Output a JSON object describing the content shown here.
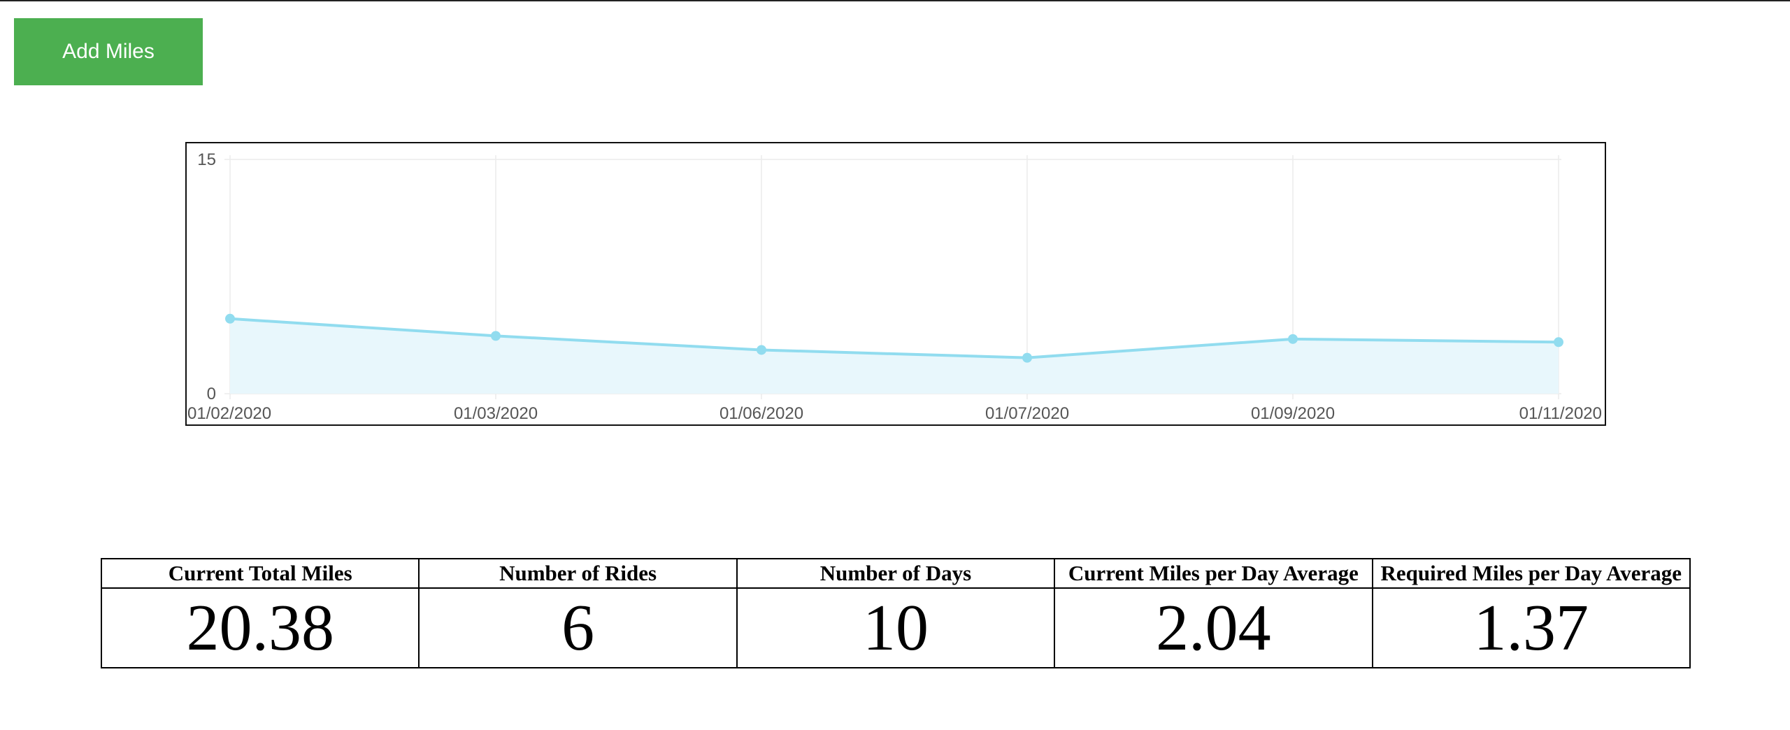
{
  "toolbar": {
    "add_miles_label": "Add Miles"
  },
  "colors": {
    "button": "#4caf50",
    "line": "#91dcef",
    "fill": "#e8f7fc",
    "grid": "#ececec"
  },
  "chart_data": {
    "type": "area",
    "categories": [
      "01/02/2020",
      "01/03/2020",
      "01/06/2020",
      "01/07/2020",
      "01/09/2020",
      "01/11/2020"
    ],
    "series": [
      {
        "values": [
          4.8,
          3.7,
          2.8,
          2.3,
          3.5,
          3.3
        ]
      }
    ],
    "ylim": [
      0,
      15
    ],
    "yticks": [
      "0",
      "15"
    ],
    "grid": true,
    "legend": "none"
  },
  "stats": {
    "headers": [
      "Current Total Miles",
      "Number of Rides",
      "Number of Days",
      "Current Miles per Day Average",
      "Required Miles per Day Average"
    ],
    "values": [
      "20.38",
      "6",
      "10",
      "2.04",
      "1.37"
    ]
  }
}
